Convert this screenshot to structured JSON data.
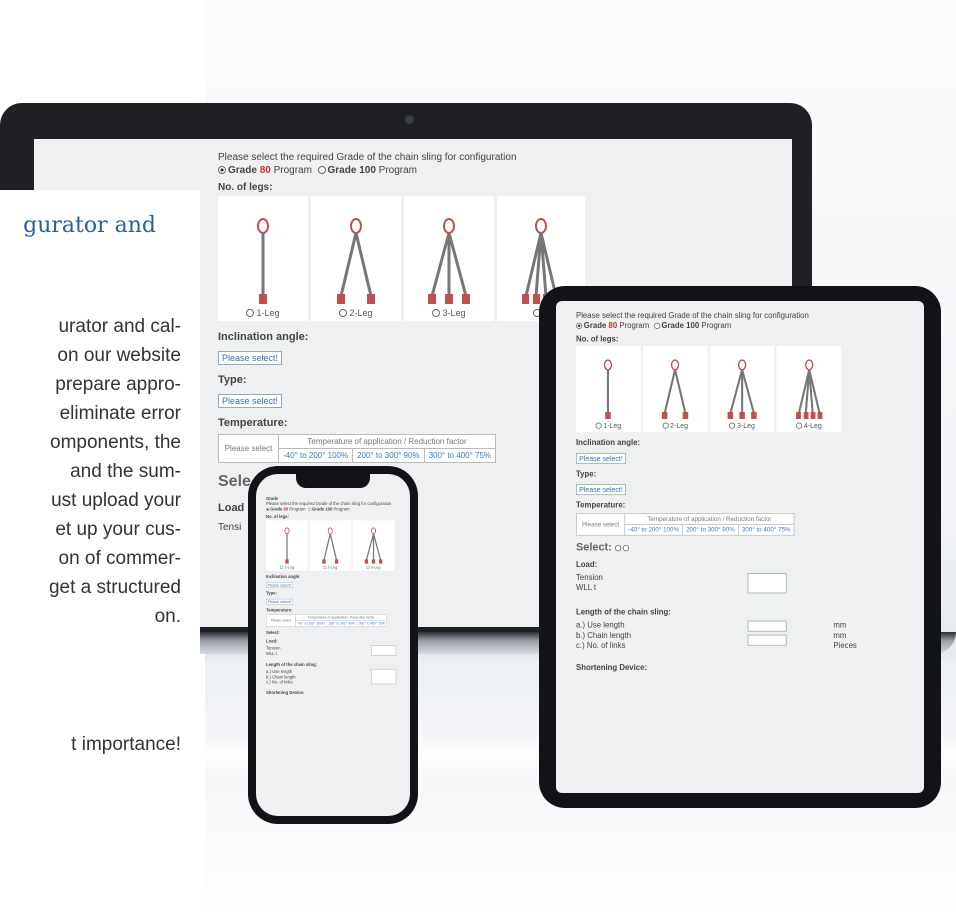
{
  "panel": {
    "title": "gurator and",
    "lines": [
      "urator and cal-",
      "on our website",
      "prepare appro-",
      "eliminate error",
      "omponents, the",
      "and the sum-",
      "ust upload your",
      "et up your cus-",
      "on of commer-",
      "get a structured",
      "on."
    ],
    "footer": "t importance!"
  },
  "configurator": {
    "prompt": "Please select the required Grade of the chain sling for configuration",
    "grade_label": "Grade",
    "grade80": "80",
    "grade100": "100",
    "program": "Program",
    "legs_heading": "No. of legs:",
    "legs": [
      "1-Leg",
      "2-Leg",
      "3-Leg",
      "4-Leg"
    ],
    "leg4_partial": "4",
    "inclination_heading": "Inclination angle:",
    "select_placeholder": "Please select!",
    "type_heading": "Type:",
    "temperature_heading": "Temperature:",
    "temp_header": "Temperature of application / Reduction factor",
    "temp_first": "Please select",
    "temps": [
      "-40° to 200° 100%",
      "200° to 300° 90%",
      "300° to 400° 75%"
    ],
    "select_label": "Select:",
    "load_heading": "Load:",
    "tension": "Tension",
    "wll": "WLL t",
    "length_heading": "Length of the chain sling:",
    "length_rows": [
      "a.) Use length",
      "b.) Chain length",
      "c.) No. of links"
    ],
    "units": [
      "mm",
      "mm",
      "Pieces"
    ],
    "shortening_heading": "Shortening Device:"
  },
  "laptop_partial": {
    "select": "Sele",
    "load": "Load",
    "tension": "Tensi"
  },
  "colors": {
    "accent": "#2a5fa0",
    "grade_red": "#c0392b",
    "device_frame": "#121316",
    "screen_bg": "#eef0f1"
  }
}
